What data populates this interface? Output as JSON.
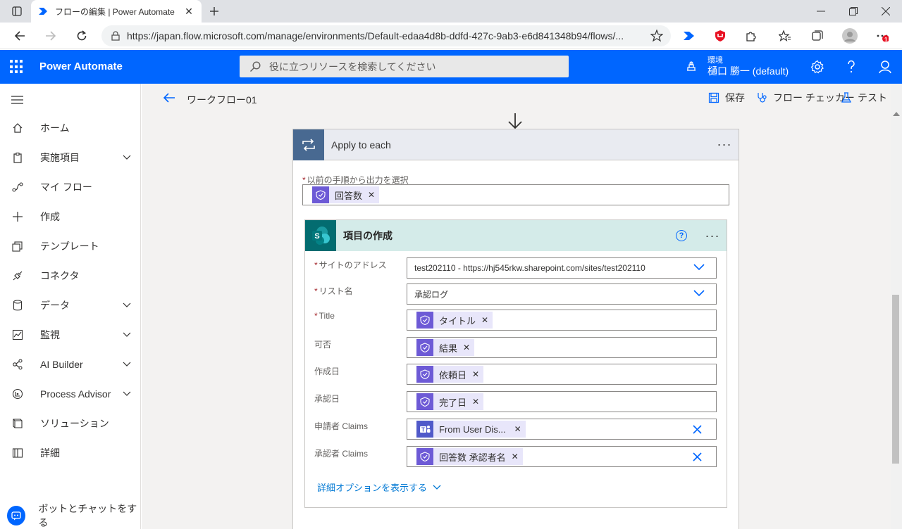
{
  "browser": {
    "tab_title": "フローの編集 | Power Automate",
    "url": "https://japan.flow.microsoft.com/manage/environments/Default-edaa4d8b-ddfd-427c-9ab3-e6d841348b94/flows/...",
    "notification_badge": "1"
  },
  "header": {
    "app_name": "Power Automate",
    "search_placeholder": "役に立つリソースを検索してください",
    "env_label": "環境",
    "env_name": "樋口 勝一 (default)"
  },
  "nav": {
    "items": [
      {
        "label": "ホーム",
        "icon": "home-icon"
      },
      {
        "label": "実施項目",
        "icon": "clipboard-icon",
        "expandable": true
      },
      {
        "label": "マイ フロー",
        "icon": "flow-icon"
      },
      {
        "label": "作成",
        "icon": "plus-icon"
      },
      {
        "label": "テンプレート",
        "icon": "template-icon"
      },
      {
        "label": "コネクタ",
        "icon": "connector-icon"
      },
      {
        "label": "データ",
        "icon": "database-icon",
        "expandable": true
      },
      {
        "label": "監視",
        "icon": "monitor-icon",
        "expandable": true
      },
      {
        "label": "AI Builder",
        "icon": "ai-builder-icon",
        "expandable": true
      },
      {
        "label": "Process Advisor",
        "icon": "process-advisor-icon",
        "expandable": true
      },
      {
        "label": "ソリューション",
        "icon": "solution-icon"
      },
      {
        "label": "詳細",
        "icon": "book-icon"
      }
    ],
    "bot_label": "ボットとチャットをする"
  },
  "command_bar": {
    "flow_name": "ワークフロー01",
    "save": "保存",
    "checker": "フロー チェッカー",
    "test": "テスト"
  },
  "apply_each": {
    "title": "Apply to each",
    "select_label": "以前の手順から出力を選択",
    "token": "回答数"
  },
  "create_item": {
    "title": "項目の作成",
    "advanced": "詳細オプションを表示する",
    "fields": [
      {
        "label": "サイトのアドレス",
        "required": true,
        "value": "test202110 - https://hj545rkw.sharepoint.com/sites/test202110",
        "type": "dropdown"
      },
      {
        "label": "リスト名",
        "required": true,
        "value": "承認ログ",
        "type": "dropdown"
      },
      {
        "label": "Title",
        "required": true,
        "token": "タイトル",
        "type": "token"
      },
      {
        "label": "可否",
        "required": false,
        "token": "結果",
        "type": "token"
      },
      {
        "label": "作成日",
        "required": false,
        "token": "依頼日",
        "type": "token"
      },
      {
        "label": "承認日",
        "required": false,
        "token": "完了日",
        "type": "token"
      },
      {
        "label": "申請者 Claims",
        "required": false,
        "token": "From User Dis...",
        "type": "token-teams",
        "clearable": true
      },
      {
        "label": "承認者 Claims",
        "required": false,
        "token": "回答数 承認者名",
        "type": "token",
        "clearable": true
      }
    ]
  },
  "colors": {
    "brand": "#0066ff",
    "token_icon": "#6d5ad6",
    "sharepoint": "#036c70",
    "loop_header": "#486991"
  }
}
